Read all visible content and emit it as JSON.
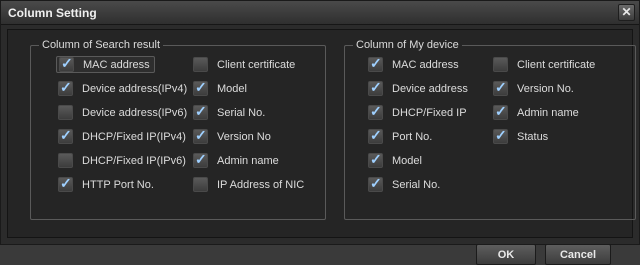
{
  "dialog": {
    "title": "Column Setting",
    "close_glyph": "✕",
    "ok_label": "OK",
    "cancel_label": "Cancel"
  },
  "search_group": {
    "title": "Column of Search result",
    "items": [
      {
        "label": "MAC address",
        "checked": true
      },
      {
        "label": "Device address(IPv4)",
        "checked": true
      },
      {
        "label": "Device address(IPv6)",
        "checked": false
      },
      {
        "label": "DHCP/Fixed IP(IPv4)",
        "checked": true
      },
      {
        "label": "DHCP/Fixed IP(IPv6)",
        "checked": false
      },
      {
        "label": "HTTP Port No.",
        "checked": true
      },
      {
        "label": "Client certificate",
        "checked": false
      },
      {
        "label": "Model",
        "checked": true
      },
      {
        "label": "Serial No.",
        "checked": true
      },
      {
        "label": "Version No",
        "checked": true
      },
      {
        "label": "Admin name",
        "checked": true
      },
      {
        "label": "IP Address of NIC",
        "checked": false
      }
    ]
  },
  "device_group": {
    "title": "Column of My device",
    "items": [
      {
        "label": "MAC address",
        "checked": true
      },
      {
        "label": "Device address",
        "checked": true
      },
      {
        "label": "DHCP/Fixed IP",
        "checked": true
      },
      {
        "label": "Port No.",
        "checked": true
      },
      {
        "label": "Model",
        "checked": true
      },
      {
        "label": "Serial No.",
        "checked": true
      },
      {
        "label": "Client certificate",
        "checked": false
      },
      {
        "label": "Version No.",
        "checked": true
      },
      {
        "label": "Admin name",
        "checked": true
      },
      {
        "label": "Status",
        "checked": true
      }
    ]
  },
  "colors": {
    "background": "#2b2b2b",
    "titlebar": "#3c3c3c",
    "check": "#9fd0ff"
  },
  "icons": {
    "check": "check-icon",
    "close": "close-icon"
  }
}
